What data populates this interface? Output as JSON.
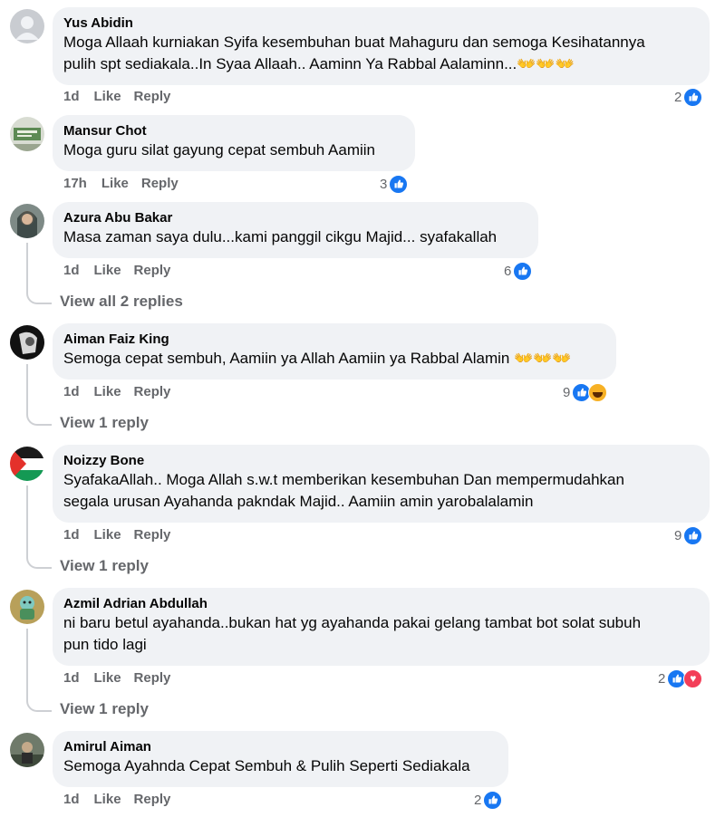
{
  "comments": [
    {
      "author": "Yus Abidin",
      "lines": [
        "Moga Allaah kurniakan Syifa kesembuhan buat Mahaguru dan semoga Kesihatannya",
        "pulih spt sediakala..In Syaa Allaah.. Aaminn Ya Rabbal Aalaminn...👐👐👐"
      ],
      "time": "1d",
      "like": "Like",
      "reply": "Reply",
      "react_count": "2",
      "reactions": [
        "like-icon"
      ],
      "view_replies": ""
    },
    {
      "author": "Mansur Chot",
      "lines": [
        "Moga guru silat gayung cepat sembuh Aamiin"
      ],
      "time": "17h",
      "like": "Like",
      "reply": "Reply",
      "react_count": "3",
      "reactions": [
        "like-icon"
      ],
      "view_replies": ""
    },
    {
      "author": "Azura Abu Bakar",
      "lines": [
        "Masa zaman saya dulu...kami panggil cikgu Majid... syafakallah"
      ],
      "time": "1d",
      "like": "Like",
      "reply": "Reply",
      "react_count": "6",
      "reactions": [
        "like-icon"
      ],
      "view_replies": "View all 2 replies"
    },
    {
      "author": "Aiman Faiz King",
      "lines": [
        "Semoga cepat sembuh, Aamiin ya Allah Aamiin ya Rabbal Alamin 👐👐👐"
      ],
      "time": "1d",
      "like": "Like",
      "reply": "Reply",
      "react_count": "9",
      "reactions": [
        "like-icon",
        "haha-icon"
      ],
      "view_replies": "View 1 reply"
    },
    {
      "author": "Noizzy Bone",
      "lines": [
        "SyafakaAllah.. Moga Allah s.w.t memberikan kesembuhan Dan mempermudahkan",
        "segala urusan Ayahanda pakndak Majid.. Aamiin amin yarobalalamin"
      ],
      "time": "1d",
      "like": "Like",
      "reply": "Reply",
      "react_count": "9",
      "reactions": [
        "like-icon"
      ],
      "view_replies": "View 1 reply"
    },
    {
      "author": "Azmil Adrian Abdullah",
      "lines": [
        "ni baru betul ayahanda..bukan hat yg ayahanda pakai gelang tambat bot solat subuh",
        "pun tido lagi"
      ],
      "time": "1d",
      "like": "Like",
      "reply": "Reply",
      "react_count": "2",
      "reactions": [
        "like-icon",
        "love-icon"
      ],
      "view_replies": "View 1 reply"
    },
    {
      "author": "Amirul Aiman",
      "lines": [
        "Semoga Ayahnda Cepat Sembuh & Pulih Seperti Sediakala"
      ],
      "time": "1d",
      "like": "Like",
      "reply": "Reply",
      "react_count": "2",
      "reactions": [
        "like-icon"
      ],
      "view_replies": ""
    }
  ],
  "colors": {
    "bubble": "#f0f2f5",
    "meta_text": "#65676b",
    "like_blue": "#1877f2",
    "love_red": "#f33e58",
    "haha_yellow": "#f7b125"
  }
}
